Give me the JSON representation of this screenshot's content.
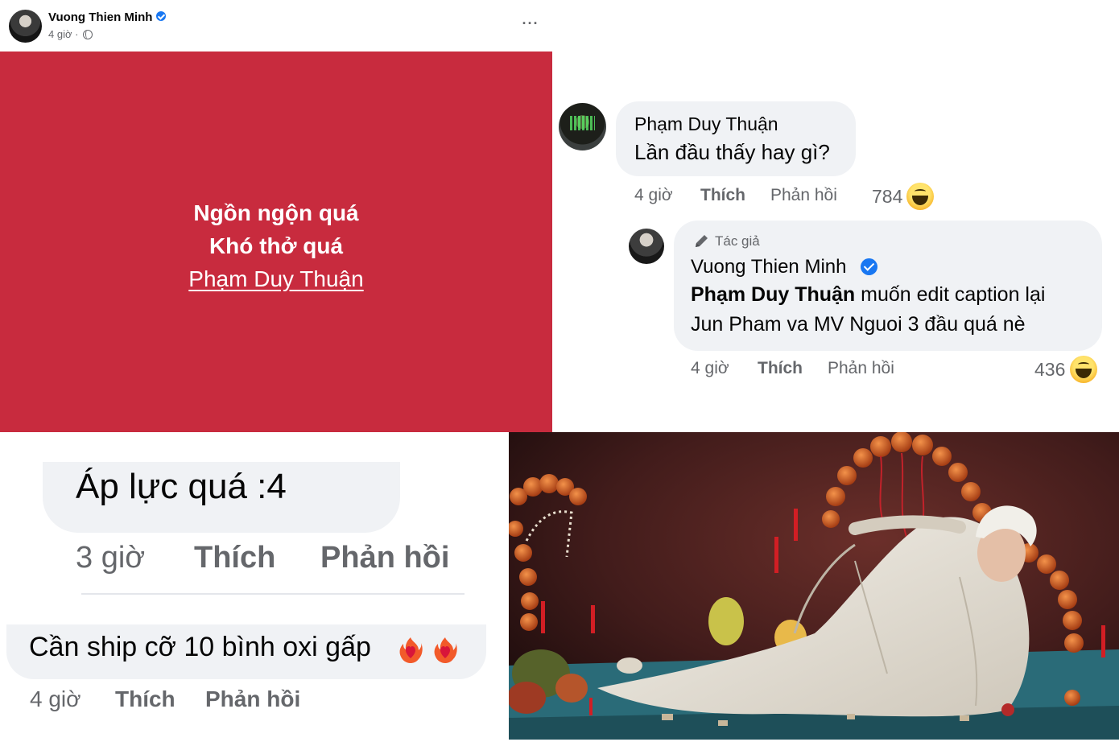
{
  "post": {
    "author": "Vuong Thien Minh",
    "time": "4 giờ ·",
    "more": "···",
    "status_lines": [
      "Ngồn ngộn quá",
      "Khó thở quá"
    ],
    "status_mention": "Phạm Duy Thuận",
    "status_bg": "#c82b3e"
  },
  "thread": {
    "comment": {
      "name": "Phạm Duy Thuận",
      "text": "Lần đầu thấy hay gì?",
      "time": "4 giờ",
      "like": "Thích",
      "reply": "Phản hồi",
      "reaction_count": "784",
      "reaction_icon": "haha-icon"
    },
    "reply": {
      "badge": "Tác giả",
      "name": "Vuong Thien Minh",
      "mention": "Phạm Duy Thuận",
      "text_1": " muốn edit caption lại",
      "text_2": "Jun Pham va MV Nguoi 3 đầu quá nè",
      "time": "4 giờ",
      "like": "Thích",
      "reply": "Phản hồi",
      "reaction_count": "436",
      "reaction_icon": "haha-icon"
    }
  },
  "comment_a": {
    "text": "Áp lực quá :4",
    "time": "3 giờ",
    "like": "Thích",
    "reply": "Phản hồi"
  },
  "comment_b": {
    "text": "Cần ship cỡ 10 bình oxi gấp",
    "emoji": [
      "heart-on-fire-icon",
      "heart-on-fire-icon"
    ],
    "time": "4 giờ",
    "like": "Thích",
    "reply": "Phản hồi"
  },
  "colors": {
    "verified": "#1877f2",
    "bubble": "#f0f2f5",
    "meta_text": "#65676b"
  }
}
